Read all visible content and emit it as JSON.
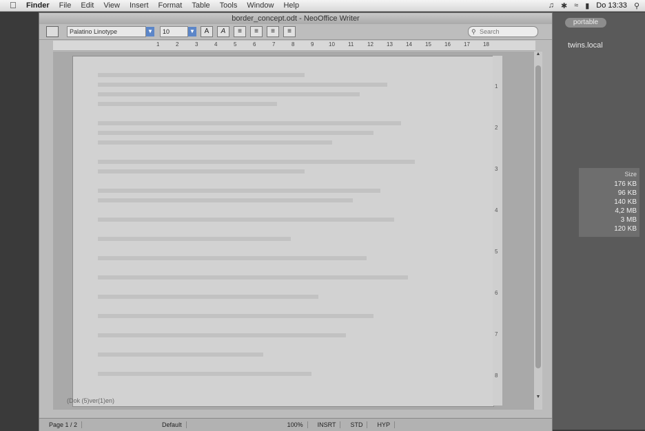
{
  "menubar": {
    "app_name": "Finder",
    "items": [
      "File",
      "Edit",
      "View",
      "Insert",
      "Format",
      "Table",
      "Tools",
      "Window",
      "Help"
    ],
    "clock": "Do 13:33"
  },
  "bg_window": {
    "button": "portable",
    "host": "twins.local",
    "size_header": "Size",
    "sizes": [
      "176 KB",
      "96 KB",
      "140 KB",
      "4,2 MB",
      "3 MB",
      "120 KB"
    ]
  },
  "writer": {
    "title": "border_concept.odt - NeoOffice Writer",
    "font_name": "Palatino Linotype",
    "font_size": "10",
    "search_placeholder": "Search",
    "ruler_ticks": [
      "1",
      "2",
      "3",
      "4",
      "5",
      "6",
      "7",
      "8",
      "9",
      "10",
      "11",
      "12",
      "13",
      "14",
      "15",
      "16",
      "17",
      "18"
    ],
    "vruler_ticks": [
      "1",
      "2",
      "3",
      "4",
      "5",
      "6",
      "7",
      "8"
    ],
    "doc_status": "(Dok (5)ver(1)en)",
    "status": {
      "page": "Page 1 / 2",
      "style": "Default",
      "zoom": "100%",
      "mode": "INSRT",
      "sel": "STD",
      "hyp": "HYP"
    }
  },
  "colors": {
    "accent": "#5c86c8"
  }
}
